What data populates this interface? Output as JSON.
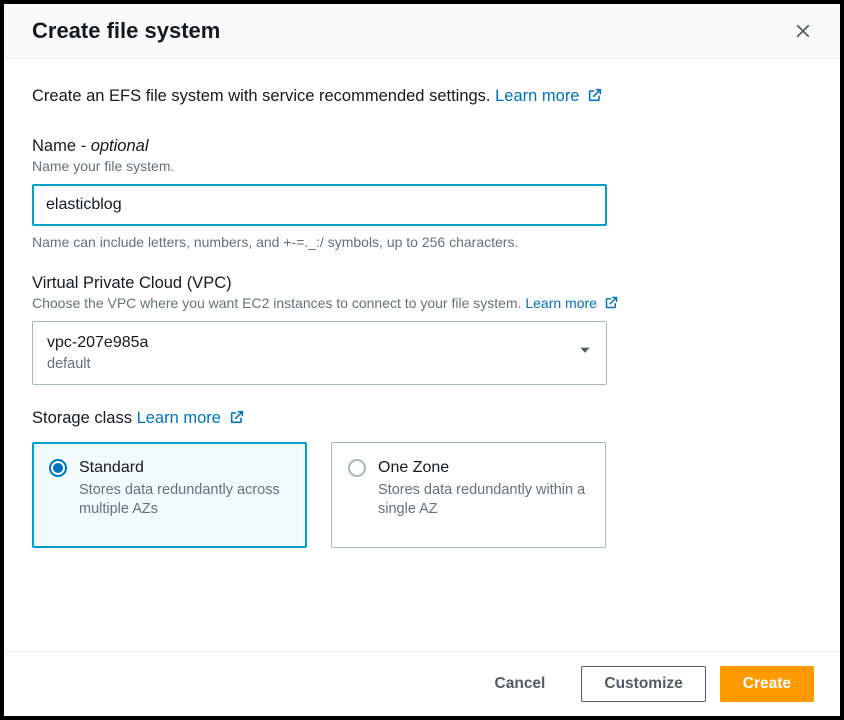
{
  "header": {
    "title": "Create file system"
  },
  "intro": {
    "text": "Create an EFS file system with service recommended settings.",
    "link": "Learn more"
  },
  "name": {
    "label_prefix": "Name ",
    "label_optional": "- optional",
    "desc": "Name your file system.",
    "value": "elasticblog",
    "hint": "Name can include letters, numbers, and +-=._:/ symbols, up to 256 characters."
  },
  "vpc": {
    "label": "Virtual Private Cloud (VPC)",
    "desc": "Choose the VPC where you want EC2 instances to connect to your file system.",
    "learn_more": "Learn more",
    "selected_id": "vpc-207e985a",
    "selected_sub": "default"
  },
  "storage": {
    "label": "Storage class",
    "learn_more": "Learn more",
    "options": [
      {
        "title": "Standard",
        "desc": "Stores data redundantly across multiple AZs",
        "selected": true
      },
      {
        "title": "One Zone",
        "desc": "Stores data redundantly within a single AZ",
        "selected": false
      }
    ]
  },
  "footer": {
    "cancel": "Cancel",
    "customize": "Customize",
    "create": "Create"
  }
}
